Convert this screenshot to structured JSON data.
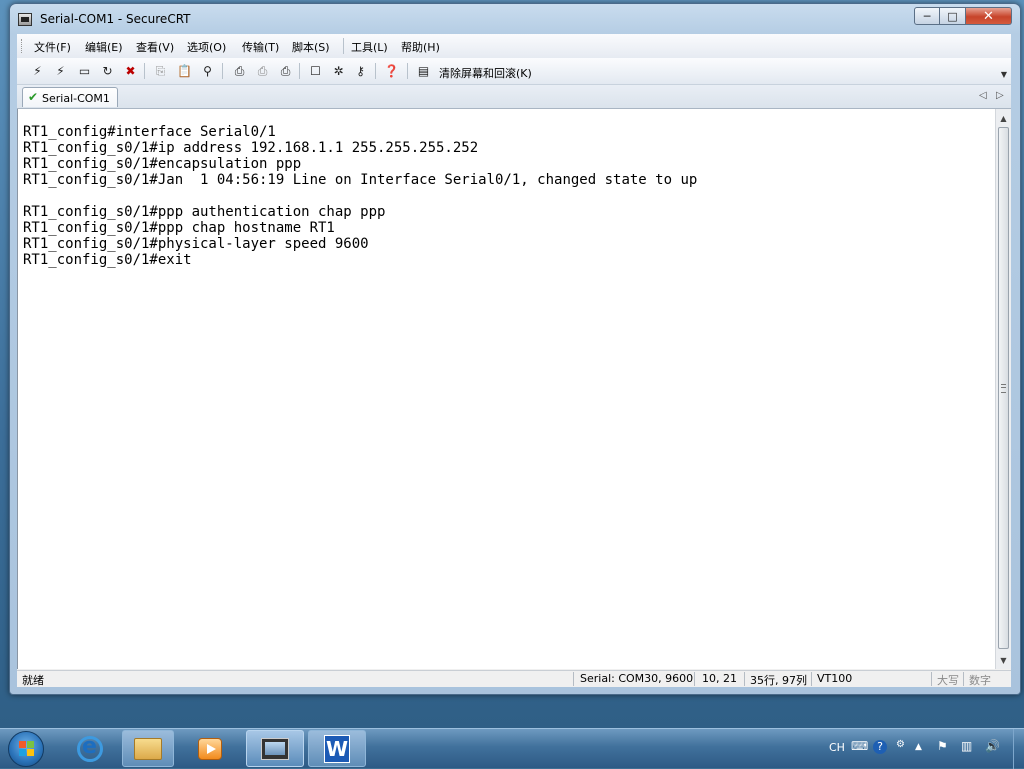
{
  "window": {
    "title": "Serial-COM1 - SecureCRT",
    "controls": {
      "minimize": "─",
      "maximize": "□",
      "close": "✕"
    }
  },
  "menubar": {
    "items": [
      "文件(F)",
      "编辑(E)",
      "查看(V)",
      "选项(O)",
      "传输(T)",
      "脚本(S)",
      "工具(L)",
      "帮助(H)"
    ]
  },
  "toolbar": {
    "icons": [
      "connect-icon",
      "quick-connect-icon",
      "connect-in-tab-icon",
      "reconnect-icon",
      "disconnect-icon",
      "copy-icon",
      "paste-icon",
      "find-icon",
      "print-icon",
      "print-selection-icon",
      "print-setup-icon",
      "session-options-icon",
      "global-options-icon",
      "keymap-icon",
      "help-icon",
      "clear-screen-icon"
    ],
    "clear_label": "清除屏幕和回滚(K)"
  },
  "tabs": [
    {
      "label": "Serial-COM1",
      "connected": true
    }
  ],
  "terminal": {
    "lines": [
      "RT1_config#interface Serial0/1",
      "RT1_config_s0/1#ip address 192.168.1.1 255.255.255.252",
      "RT1_config_s0/1#encapsulation ppp",
      "RT1_config_s0/1#Jan  1 04:56:19 Line on Interface Serial0/1, changed state to up",
      "",
      "RT1_config_s0/1#ppp authentication chap ppp",
      "RT1_config_s0/1#ppp chap hostname RT1",
      "RT1_config_s0/1#physical-layer speed 9600",
      "RT1_config_s0/1#exit"
    ]
  },
  "statusbar": {
    "ready": "就绪",
    "connection": "Serial: COM30, 9600",
    "cursor": "10,  21",
    "size": "35行, 97列",
    "emulation": "VT100",
    "caps": "大写",
    "num": "数字"
  },
  "taskbar": {
    "apps": [
      "internet-explorer-icon",
      "file-explorer-icon",
      "media-player-icon",
      "securecrt-icon",
      "wps-writer-icon"
    ],
    "wps_letter": "W",
    "tray": {
      "language": "CH",
      "keyboard": "⌨",
      "help": "?",
      "arrow": "▲"
    }
  }
}
